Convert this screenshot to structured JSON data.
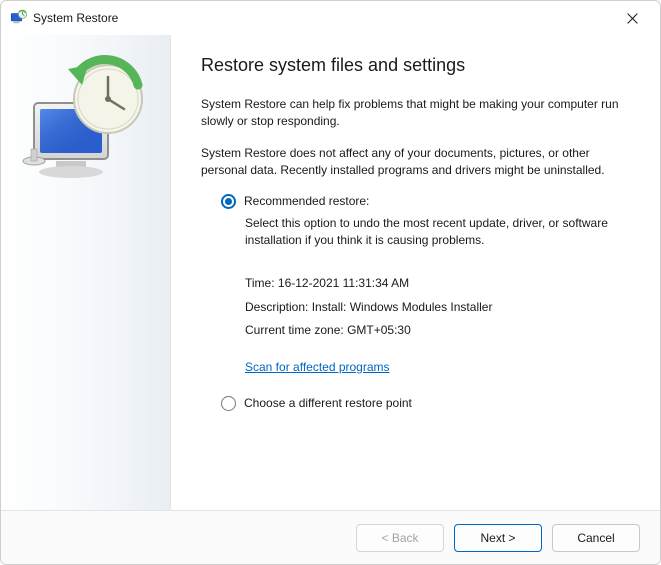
{
  "window": {
    "title": "System Restore"
  },
  "main": {
    "heading": "Restore system files and settings",
    "paragraph1": "System Restore can help fix problems that might be making your computer run slowly or stop responding.",
    "paragraph2": "System Restore does not affect any of your documents, pictures, or other personal data. Recently installed programs and drivers might be uninstalled."
  },
  "options": {
    "recommended": {
      "label": "Recommended restore:",
      "description": "Select this option to undo the most recent update, driver, or software installation if you think it is causing problems.",
      "time_label": "Time:",
      "time_value": "16-12-2021 11:31:34 AM",
      "description_label": "Description:",
      "description_value": "Install: Windows Modules Installer",
      "timezone_label": "Current time zone:",
      "timezone_value": "GMT+05:30",
      "scan_link": "Scan for affected programs"
    },
    "different": {
      "label": "Choose a different restore point"
    }
  },
  "footer": {
    "back": "< Back",
    "next": "Next >",
    "cancel": "Cancel"
  }
}
